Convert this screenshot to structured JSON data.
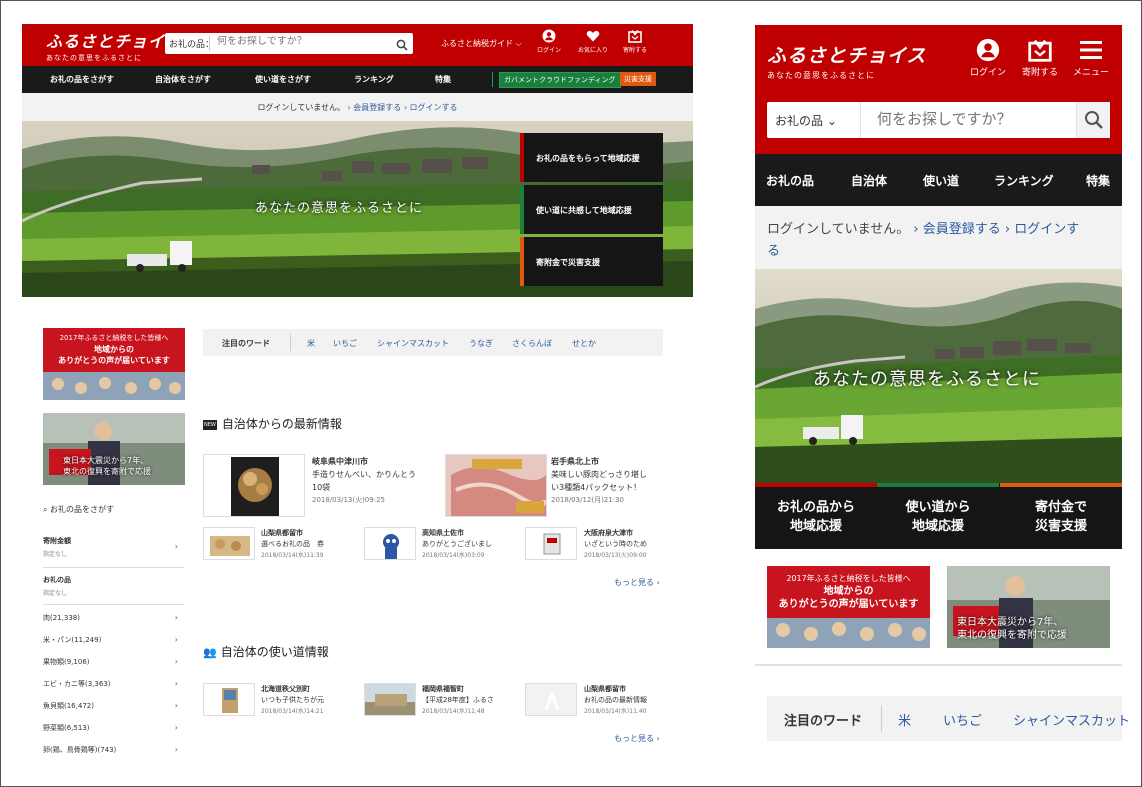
{
  "desktop": {
    "header": {
      "logo_title": "ふるさとチョイス",
      "logo_sub": "あなたの意思をふるさとに",
      "search_category": "お礼の品：",
      "search_placeholder": "何をお探しですか？",
      "guide_label": "ふるさと納税ガイド ⌵",
      "icons": [
        {
          "label": "ログイン",
          "icon": "user-icon"
        },
        {
          "label": "お気に入り",
          "icon": "heart-icon"
        },
        {
          "label": "寄附する",
          "icon": "gift-icon"
        }
      ]
    },
    "nav": {
      "items": [
        "お礼の品をさがす",
        "自治体をさがす",
        "使い道をさがす",
        "ランキング",
        "特集"
      ],
      "green_badge": "ガバメントクラウドファンディング",
      "orange_badge": "災害支援"
    },
    "login_bar": {
      "text": "ログインしていません。",
      "register": "› 会員登録する",
      "login": "› ログインする"
    },
    "hero": {
      "caption": "あなたの意思をふるさとに",
      "side_items": [
        {
          "label": "お礼の品をもらって地域応援",
          "color": "#c00000"
        },
        {
          "label": "使い道に共感して地域応援",
          "color": "#1a7f3c"
        },
        {
          "label": "寄附金で災害支援",
          "color": "#e0590f"
        }
      ]
    },
    "banners": {
      "b1_line1": "2017年ふるさと納税をした皆様へ",
      "b1_line2": "地域からの",
      "b1_line3": "ありがとうの声が届いています",
      "b2_line1": "東日本大震災から7年、",
      "b2_line2": "東北の復興を寄附で応援"
    },
    "category": {
      "title": "お礼の品をさがす",
      "amount_label": "寄附金額",
      "amount_sub": "指定なし",
      "gift_label": "お礼の品",
      "gift_sub": "指定なし",
      "items": [
        "肉(21,338)",
        "米・パン(11,249)",
        "果物類(9,106)",
        "エビ・カニ等(3,363)",
        "魚貝類(16,472)",
        "野菜類(6,513)",
        "卵(鶏、鳥骨鶏等)(743)"
      ]
    },
    "words": {
      "label": "注目のワード",
      "items": [
        "米",
        "いちご",
        "シャインマスカット",
        "うなぎ",
        "さくらんぼ",
        "せとか"
      ]
    },
    "news": {
      "title": "自治体からの最新情報",
      "new_tag": "NEW",
      "big": [
        {
          "city": "岐阜県中津川市",
          "text": "手造りせんべい、かりんとう",
          "text2": "10袋",
          "date": "2018/03/13(火)09:25"
        },
        {
          "city": "岩手県北上市",
          "text": "美味しい豚肉どっさり堪し",
          "text2": "い3種類4パックセット！",
          "date": "2018/03/12(月)21:30"
        }
      ],
      "small": [
        {
          "city": "山梨県都留市",
          "text": "選べるお礼の品　券",
          "date": "2018/03/14(水)11:39"
        },
        {
          "city": "高知県土佐市",
          "text": "ありがとうございまし",
          "date": "2018/03/14(水)03:09"
        },
        {
          "city": "大阪府泉大津市",
          "text": "いざという時のため",
          "date": "2018/03/13(火)09:00"
        }
      ],
      "more": "もっと見る ›"
    },
    "usage": {
      "title": "自治体の使い道情報",
      "items": [
        {
          "city": "北海道秩父別町",
          "text": "いつも子供たちが元",
          "date": "2018/03/14(水)14:21"
        },
        {
          "city": "福岡県福智町",
          "text": "【平成28年度】ふるさ",
          "date": "2018/03/14(水)11:48"
        },
        {
          "city": "山梨県都留市",
          "text": "お礼の品の最新情報",
          "date": "2018/03/14(水)11:40"
        }
      ],
      "more": "もっと見る ›"
    }
  },
  "mobile": {
    "header": {
      "logo_title": "ふるさとチョイス",
      "logo_sub": "あなたの意思をふるさとに",
      "icons": [
        {
          "label": "ログイン",
          "icon": "user-icon"
        },
        {
          "label": "寄附する",
          "icon": "gift-icon"
        },
        {
          "label": "メニュー",
          "icon": "menu-icon"
        }
      ],
      "search_category": "お礼の品 ⌄",
      "search_placeholder": "何をお探しですか？"
    },
    "nav": {
      "items": [
        "お礼の品",
        "自治体",
        "使い道",
        "ランキング",
        "特集"
      ]
    },
    "login_bar": {
      "text": "ログインしていません。",
      "register": "› 会員登録する",
      "login": "› ログインす",
      "login2": "る"
    },
    "hero": {
      "caption": "あなたの意思をふるさとに"
    },
    "tiles": [
      {
        "l1": "お礼の品から",
        "l2": "地域応援",
        "color": "#c00000"
      },
      {
        "l1": "使い道から",
        "l2": "地域応援",
        "color": "#1a7f3c"
      },
      {
        "l1": "寄付金で",
        "l2": "災害支援",
        "color": "#e0590f"
      }
    ],
    "banners": {
      "b1_line1": "2017年ふるさと納税をした皆様へ",
      "b1_line2": "地域からの",
      "b1_line3": "ありがとうの声が届いています",
      "b2_line1": "東日本大震災から7年、",
      "b2_line2": "東北の復興を寄附で応援"
    },
    "words": {
      "label": "注目のワード",
      "items": [
        "米",
        "いちご",
        "シャインマスカット"
      ]
    }
  }
}
